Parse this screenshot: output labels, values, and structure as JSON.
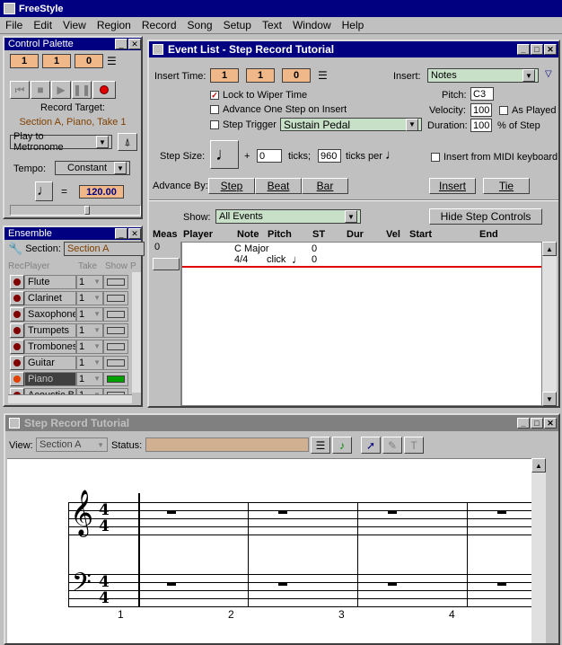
{
  "app": {
    "title": "FreeStyle"
  },
  "menu": [
    "File",
    "Edit",
    "View",
    "Region",
    "Record",
    "Song",
    "Setup",
    "Text",
    "Window",
    "Help"
  ],
  "palette": {
    "title": "Control Palette",
    "counter": [
      "1",
      "1",
      "0"
    ],
    "record_target_label": "Record Target:",
    "record_target_value": "Section A, Piano, Take 1",
    "metronome": "Play to Metronome",
    "tempo_label": "Tempo:",
    "tempo_mode": "Constant",
    "tempo_eq": "=",
    "tempo_value": "120.00"
  },
  "ensemble": {
    "title": "Ensemble",
    "section_label": "Section:",
    "section_value": "Section A",
    "headers": [
      "Rec",
      "Player",
      "Take",
      "Show",
      "P"
    ],
    "rows": [
      {
        "name": "Flute",
        "take": "1",
        "show": false,
        "selected": false
      },
      {
        "name": "Clarinet",
        "take": "1",
        "show": false,
        "selected": false
      },
      {
        "name": "Saxophone",
        "take": "1",
        "show": false,
        "selected": false
      },
      {
        "name": "Trumpets",
        "take": "1",
        "show": false,
        "selected": false
      },
      {
        "name": "Trombones",
        "take": "1",
        "show": false,
        "selected": false
      },
      {
        "name": "Guitar",
        "take": "1",
        "show": false,
        "selected": false
      },
      {
        "name": "Piano",
        "take": "1",
        "show": true,
        "selected": true
      },
      {
        "name": "Acoustic B",
        "take": "1",
        "show": false,
        "selected": false
      }
    ]
  },
  "eventlist": {
    "title": "Event List - Step Record Tutorial",
    "insert_time_label": "Insert Time:",
    "insert_time": [
      "1",
      "1",
      "0"
    ],
    "insert_label": "Insert:",
    "insert_value": "Notes",
    "lock_label": "Lock to Wiper Time",
    "advance_label": "Advance One Step on Insert",
    "step_trigger_label": "Step Trigger",
    "step_trigger_value": "Sustain Pedal",
    "pitch_label": "Pitch:",
    "pitch_value": "C3",
    "velocity_label": "Velocity:",
    "velocity_value": "100",
    "as_played_label": "As Played",
    "duration_label": "Duration:",
    "duration_value": "100",
    "duration_unit": "% of Step",
    "step_size_label": "Step Size:",
    "plus": "+",
    "ticks_value": "0",
    "ticks_label": "ticks;",
    "ticks_per_value": "960",
    "ticks_per_label": "ticks per",
    "midi_label": "Insert from MIDI keyboard",
    "advance_by_label": "Advance By:",
    "advance_buttons": [
      "Step",
      "Beat",
      "Bar"
    ],
    "insert_button": "Insert",
    "tie_button": "Tie",
    "show_label": "Show:",
    "show_value": "All Events",
    "hide_button": "Hide Step Controls",
    "columns": [
      "Meas",
      "Player",
      "Note",
      "Pitch",
      "ST",
      "Dur",
      "Vel",
      "Start",
      "End"
    ],
    "meas_value": "0",
    "events": [
      {
        "note": "C Major",
        "pitch": "",
        "st": "0"
      },
      {
        "note": "4/4",
        "pitch": "click",
        "st": "0"
      }
    ]
  },
  "notation": {
    "title": "Step Record Tutorial",
    "view_label": "View:",
    "view_value": "Section A",
    "status_label": "Status:",
    "status_value": "",
    "time_sig_top": "4",
    "time_sig_bottom": "4",
    "measures": [
      "1",
      "2",
      "3",
      "4"
    ]
  },
  "colors": {
    "title_active": "#000080",
    "accent_orange": "#f0b888",
    "accent_green": "#c8e0c8",
    "red_line": "#e00000"
  }
}
